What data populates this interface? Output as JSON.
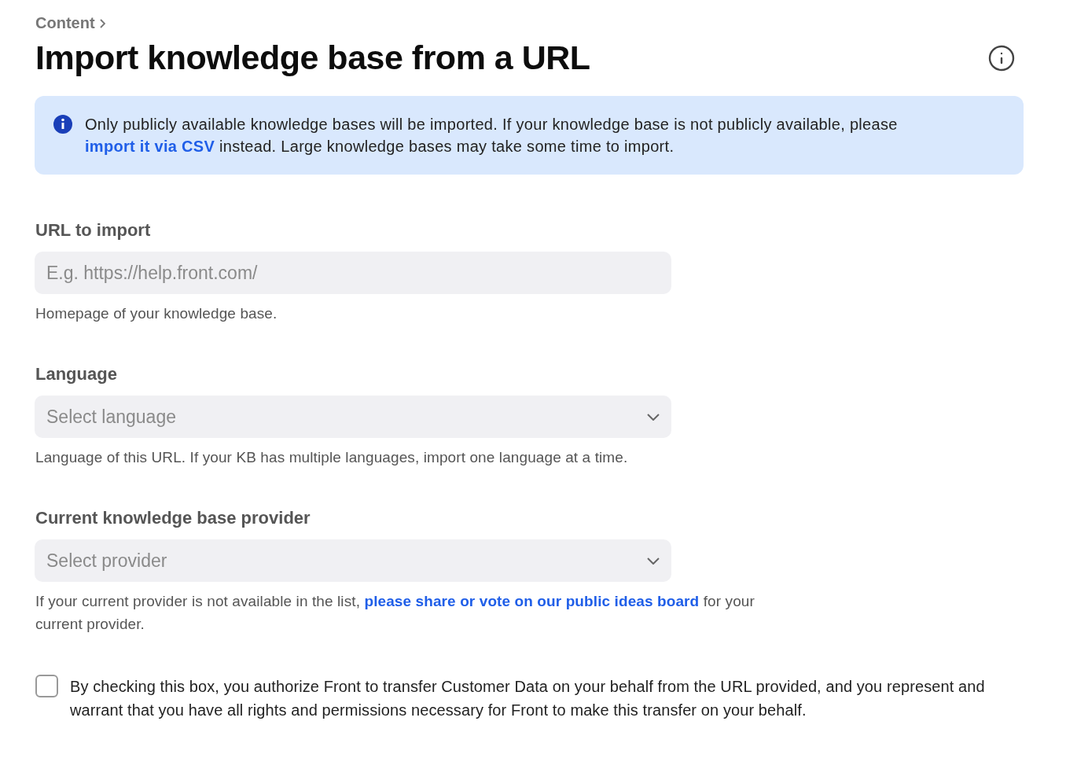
{
  "breadcrumb": {
    "label": "Content"
  },
  "title": "Import knowledge base from a URL",
  "banner": {
    "text_before": "Only publicly available knowledge bases will be imported. If your knowledge base is not publicly available, please ",
    "link": "import it via CSV",
    "text_after": " instead. Large knowledge bases may take some time to import."
  },
  "fields": [
    {
      "kind": "input",
      "label": "URL to import",
      "placeholder": "E.g. https://help.front.com/",
      "hint": {
        "text_before": "Homepage of your knowledge base."
      }
    },
    {
      "kind": "select",
      "label": "Language",
      "placeholder": "Select language",
      "hint": {
        "text_before": "Language of this URL. If your KB has multiple languages, import one language at a time."
      }
    },
    {
      "kind": "select",
      "label": "Current knowledge base provider",
      "placeholder": "Select provider",
      "hint": {
        "text_before": "If your current provider is not available in the list, ",
        "link": "please share or vote on our public ideas board",
        "text_after": " for your current provider."
      }
    }
  ],
  "consent": {
    "checked": false,
    "text": "By checking this box, you authorize Front to transfer Customer Data on your behalf from the URL provided, and you represent and warrant that you have all rights and permissions necessary for Front to make this transfer on your behalf."
  }
}
